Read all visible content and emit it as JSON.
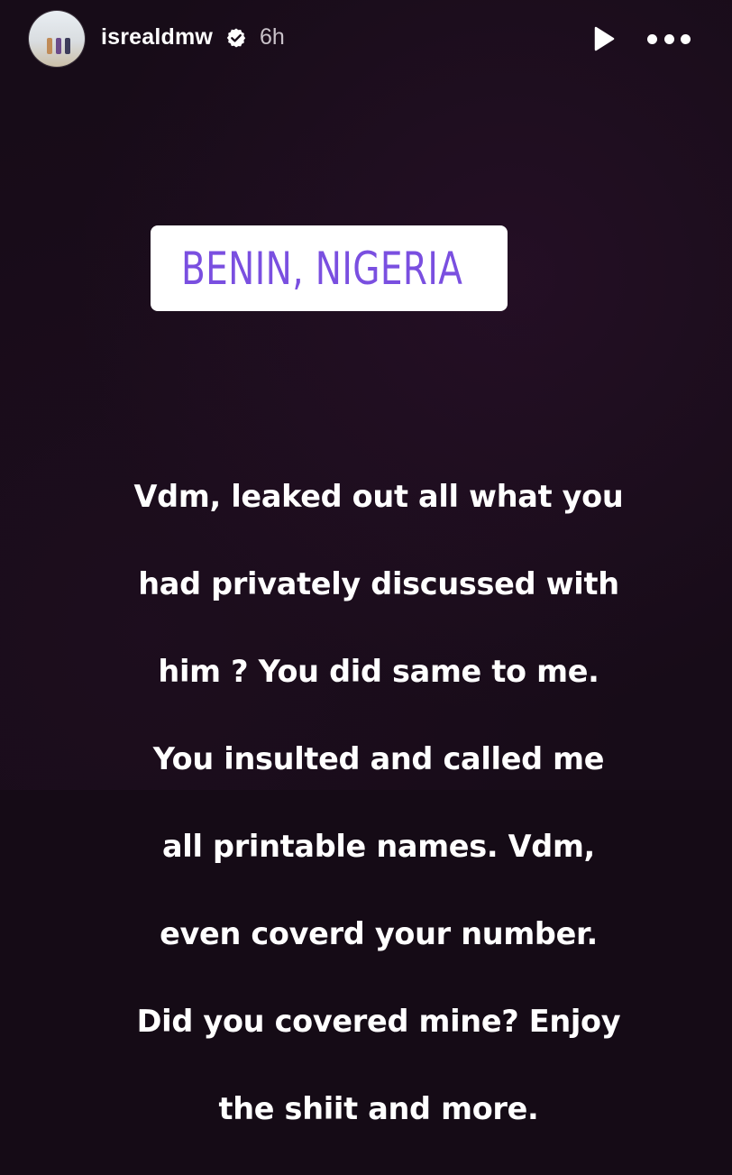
{
  "header": {
    "username": "isrealdmw",
    "time": "6h",
    "avatar_icon": "profile-photo",
    "verified_icon": "verified-badge-icon",
    "play_icon": "play-icon",
    "more_icon": "more-options-icon"
  },
  "location_sticker": {
    "text": "BENIN, NIGERIA",
    "icon": "location-pin-icon",
    "color": "#7a4fe0"
  },
  "caption": {
    "lines": [
      "Vdm, leaked out  all what you",
      "had privately discussed with",
      "him ? You did same to me.",
      "You insulted and called me",
      "all printable names. Vdm,",
      "even coverd your number.",
      "Did you covered mine? Enjoy",
      "the shiit and more."
    ]
  }
}
